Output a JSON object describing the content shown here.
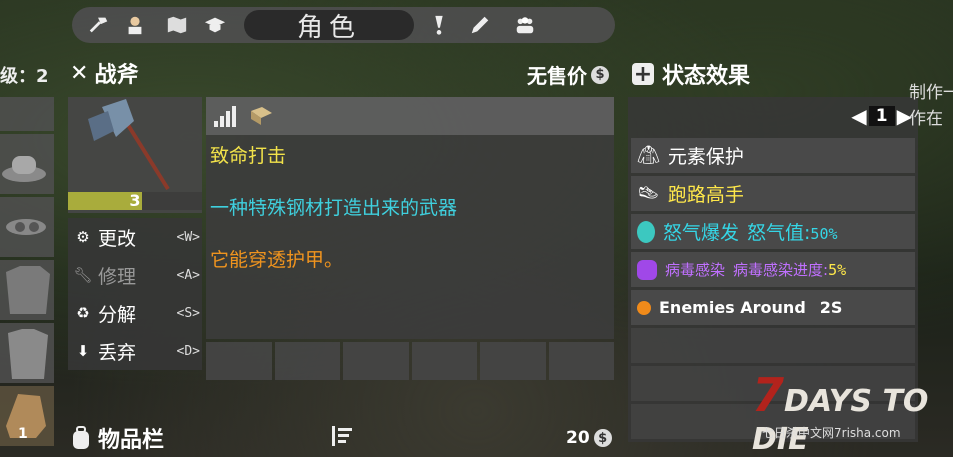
{
  "topbar": {
    "active_tab": "角色",
    "tabs": [
      "hammer-icon",
      "character-icon",
      "map-icon",
      "graduation-cap-icon",
      "character-tab",
      "exclamation-icon",
      "pencil-icon",
      "group-icon"
    ]
  },
  "left": {
    "level_label": "级：2",
    "bottom_slot_count": "1"
  },
  "item": {
    "name": "战斧",
    "price_label": "无售价",
    "quantity": "3",
    "quantity_fill": 0.55,
    "actions": [
      {
        "label": "更改",
        "key": "<W>",
        "icon": "gears-icon"
      },
      {
        "label": "修理",
        "key": "<A>",
        "icon": "wrench-icon"
      },
      {
        "label": "分解",
        "key": "<S>",
        "icon": "recycle-icon"
      },
      {
        "label": "丢弃",
        "key": "<D>",
        "icon": "arrow-down-icon"
      }
    ],
    "desc_line1": "致命打击",
    "desc_line2": "一种特殊钢材打造出来的武器",
    "desc_line3": "它能穿透护甲。"
  },
  "inventory": {
    "title": "物品栏",
    "count": "20"
  },
  "status": {
    "title": "状态效果",
    "page": "1",
    "rows": [
      {
        "text": "元素保护"
      },
      {
        "text": "跑路高手"
      },
      {
        "text": "怒气爆发",
        "extra": "怒气值:",
        "value": "50%"
      },
      {
        "text": "病毒感染",
        "extra": "病毒感染进度:",
        "value": "5%"
      },
      {
        "text": "Enemies Around",
        "value": "2S"
      }
    ]
  },
  "side": {
    "craft_line1": "制作一把",
    "craft_line2": "作在"
  },
  "logo": {
    "main": "DAYS TO DIE",
    "seven": "7",
    "sub": "七日杀中文网7risha.com"
  },
  "colors": {
    "yellow": "#f2e24a",
    "cyan": "#3fd0de",
    "orange": "#f0941e",
    "purple": "#c070ff"
  }
}
